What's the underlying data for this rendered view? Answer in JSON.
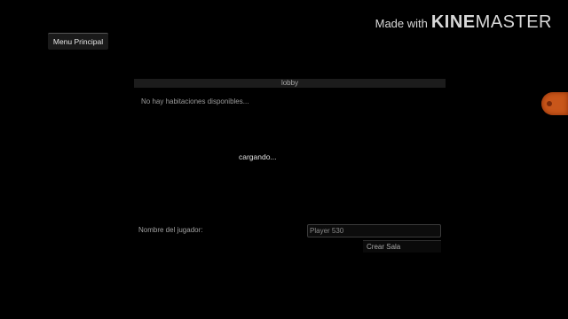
{
  "menu": {
    "main_menu_label": "Menu Principal"
  },
  "watermark": {
    "prefix": "Made with",
    "brand_bold": "KINE",
    "brand_rest": "MASTER"
  },
  "lobby": {
    "header": "lobby",
    "empty_message": "No hay habitaciones disponibles...",
    "loading_text": "cargando..."
  },
  "player": {
    "name_label": "Nombre del jugador:",
    "name_value": "Player 530"
  },
  "actions": {
    "create_room_label": "Crear Sala"
  },
  "colors": {
    "background": "#000000",
    "panel": "#1c1c1c",
    "side_handle": "#c8561a"
  }
}
